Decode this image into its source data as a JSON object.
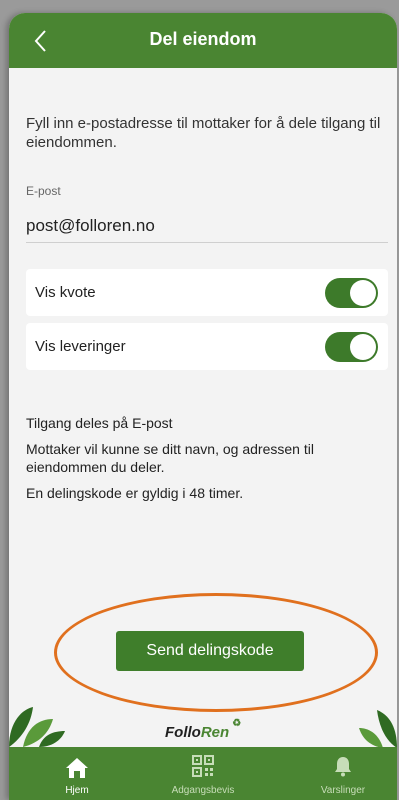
{
  "header": {
    "title": "Del eiendom"
  },
  "intro_text": "Fyll inn e-postadresse til mottaker for å dele tilgang til eiendommen.",
  "email": {
    "label": "E-post",
    "value": "post@folloren.no"
  },
  "toggles": [
    {
      "label": "Vis kvote",
      "on": true
    },
    {
      "label": "Vis leveringer",
      "on": true
    }
  ],
  "info": {
    "line1": "Tilgang deles på E-post",
    "line2": "Mottaker vil kunne se ditt navn, og adressen til eiendommen du deler.",
    "line3": "En delingskode er gyldig i 48 timer."
  },
  "send_button": "Send delingskode",
  "logo": {
    "part1": "Follo",
    "part2": "Ren"
  },
  "tabs": [
    {
      "label": "Hjem",
      "icon": "home-icon",
      "active": true
    },
    {
      "label": "Adgangsbevis",
      "icon": "qr-code-icon",
      "active": false
    },
    {
      "label": "Varslinger",
      "icon": "bell-icon",
      "active": false
    }
  ],
  "colors": {
    "brand_green": "#4a8532",
    "highlight_oval": "#e0701e"
  }
}
